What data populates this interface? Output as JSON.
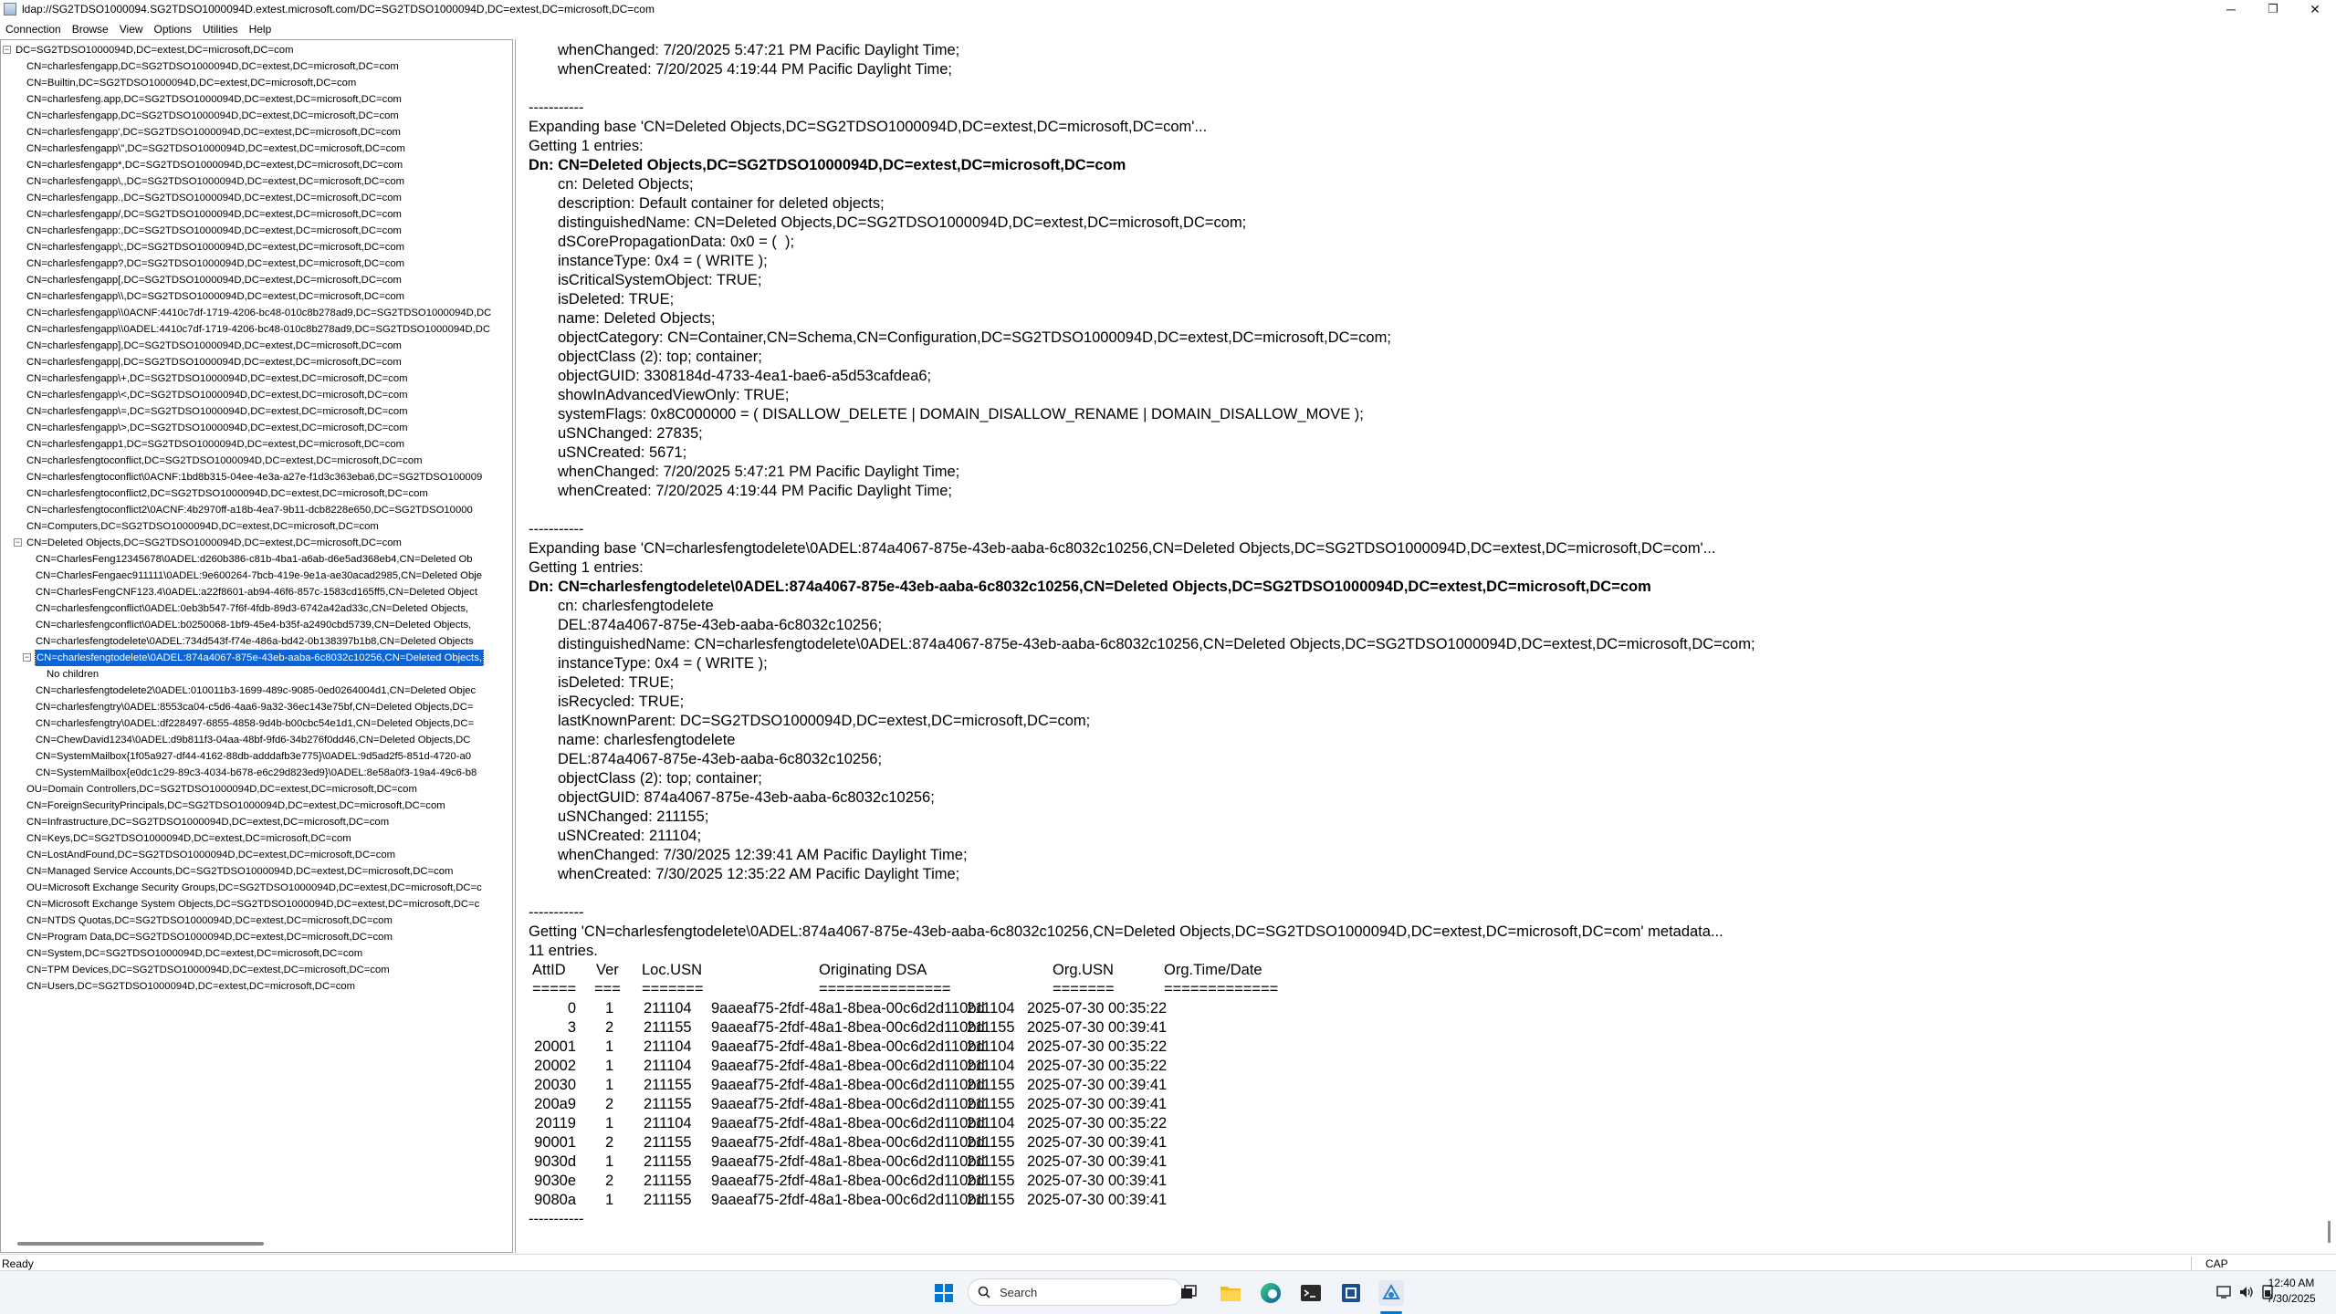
{
  "window": {
    "title": "ldap://SG2TDSO1000094.SG2TDSO1000094D.extest.microsoft.com/DC=SG2TDSO1000094D,DC=extest,DC=microsoft,DC=com",
    "minimize": "─",
    "maximize": "❐",
    "close": "✕"
  },
  "menu": [
    "Connection",
    "Browse",
    "View",
    "Options",
    "Utilities",
    "Help"
  ],
  "tree": [
    {
      "label": "DC=SG2TDSO1000094D,DC=extest,DC=microsoft,DC=com",
      "level": 0,
      "expander": "−"
    },
    {
      "label": "CN=charlesfengapp,DC=SG2TDSO1000094D,DC=extest,DC=microsoft,DC=com",
      "level": 1
    },
    {
      "label": "CN=Builtin,DC=SG2TDSO1000094D,DC=extest,DC=microsoft,DC=com",
      "level": 1
    },
    {
      "label": "CN=charlesfeng.app,DC=SG2TDSO1000094D,DC=extest,DC=microsoft,DC=com",
      "level": 1
    },
    {
      "label": "CN=charlesfengapp,DC=SG2TDSO1000094D,DC=extest,DC=microsoft,DC=com",
      "level": 1
    },
    {
      "label": "CN=charlesfengapp',DC=SG2TDSO1000094D,DC=extest,DC=microsoft,DC=com",
      "level": 1
    },
    {
      "label": "CN=charlesfengapp\\\",DC=SG2TDSO1000094D,DC=extest,DC=microsoft,DC=com",
      "level": 1
    },
    {
      "label": "CN=charlesfengapp*,DC=SG2TDSO1000094D,DC=extest,DC=microsoft,DC=com",
      "level": 1
    },
    {
      "label": "CN=charlesfengapp\\,,DC=SG2TDSO1000094D,DC=extest,DC=microsoft,DC=com",
      "level": 1
    },
    {
      "label": "CN=charlesfengapp.,DC=SG2TDSO1000094D,DC=extest,DC=microsoft,DC=com",
      "level": 1
    },
    {
      "label": "CN=charlesfengapp/,DC=SG2TDSO1000094D,DC=extest,DC=microsoft,DC=com",
      "level": 1
    },
    {
      "label": "CN=charlesfengapp:,DC=SG2TDSO1000094D,DC=extest,DC=microsoft,DC=com",
      "level": 1
    },
    {
      "label": "CN=charlesfengapp\\;,DC=SG2TDSO1000094D,DC=extest,DC=microsoft,DC=com",
      "level": 1
    },
    {
      "label": "CN=charlesfengapp?,DC=SG2TDSO1000094D,DC=extest,DC=microsoft,DC=com",
      "level": 1
    },
    {
      "label": "CN=charlesfengapp[,DC=SG2TDSO1000094D,DC=extest,DC=microsoft,DC=com",
      "level": 1
    },
    {
      "label": "CN=charlesfengapp\\\\,DC=SG2TDSO1000094D,DC=extest,DC=microsoft,DC=com",
      "level": 1
    },
    {
      "label": "CN=charlesfengapp\\\\0ACNF:4410c7df-1719-4206-bc48-010c8b278ad9,DC=SG2TDSO1000094D,DC",
      "level": 1
    },
    {
      "label": "CN=charlesfengapp\\\\0ADEL:4410c7df-1719-4206-bc48-010c8b278ad9,DC=SG2TDSO1000094D,DC",
      "level": 1
    },
    {
      "label": "CN=charlesfengapp],DC=SG2TDSO1000094D,DC=extest,DC=microsoft,DC=com",
      "level": 1
    },
    {
      "label": "CN=charlesfengapp|,DC=SG2TDSO1000094D,DC=extest,DC=microsoft,DC=com",
      "level": 1
    },
    {
      "label": "CN=charlesfengapp\\+,DC=SG2TDSO1000094D,DC=extest,DC=microsoft,DC=com",
      "level": 1
    },
    {
      "label": "CN=charlesfengapp\\<,DC=SG2TDSO1000094D,DC=extest,DC=microsoft,DC=com",
      "level": 1
    },
    {
      "label": "CN=charlesfengapp\\=,DC=SG2TDSO1000094D,DC=extest,DC=microsoft,DC=com",
      "level": 1
    },
    {
      "label": "CN=charlesfengapp\\>,DC=SG2TDSO1000094D,DC=extest,DC=microsoft,DC=com",
      "level": 1
    },
    {
      "label": "CN=charlesfengapp1,DC=SG2TDSO1000094D,DC=extest,DC=microsoft,DC=com",
      "level": 1
    },
    {
      "label": "CN=charlesfengtoconflict,DC=SG2TDSO1000094D,DC=extest,DC=microsoft,DC=com",
      "level": 1
    },
    {
      "label": "CN=charlesfengtoconflict\\0ACNF:1bd8b315-04ee-4e3a-a27e-f1d3c363eba6,DC=SG2TDSO100009",
      "level": 1
    },
    {
      "label": "CN=charlesfengtoconflict2,DC=SG2TDSO1000094D,DC=extest,DC=microsoft,DC=com",
      "level": 1
    },
    {
      "label": "CN=charlesfengtoconflict2\\0ACNF:4b2970ff-a18b-4ea7-9b11-dcb8228e650,DC=SG2TDSO10000",
      "level": 1
    },
    {
      "label": "CN=Computers,DC=SG2TDSO1000094D,DC=extest,DC=microsoft,DC=com",
      "level": 1
    },
    {
      "label": "CN=Deleted Objects,DC=SG2TDSO1000094D,DC=extest,DC=microsoft,DC=com",
      "level": 1,
      "expander": "−"
    },
    {
      "label": "CN=CharlesFeng12345678\\0ADEL:d260b386-c81b-4ba1-a6ab-d6e5ad368eb4,CN=Deleted Ob",
      "level": 2
    },
    {
      "label": "CN=CharlesFengaec911111\\0ADEL:9e600264-7bcb-419e-9e1a-ae30acad2985,CN=Deleted Obje",
      "level": 2
    },
    {
      "label": "CN=CharlesFengCNF123.4\\0ADEL:a22f8601-ab94-46f6-857c-1583cd165ff5,CN=Deleted Object",
      "level": 2
    },
    {
      "label": "CN=charlesfengconflict\\0ADEL:0eb3b547-7f6f-4fdb-89d3-6742a42ad33c,CN=Deleted Objects,",
      "level": 2
    },
    {
      "label": "CN=charlesfengconflict\\0ADEL:b0250068-1bf9-45e4-b35f-a2490cbd5739,CN=Deleted Objects,",
      "level": 2
    },
    {
      "label": "CN=charlesfengtodelete\\0ADEL:734d543f-f74e-486a-bd42-0b138397b1b8,CN=Deleted Objects",
      "level": 2
    },
    {
      "label": "CN=charlesfengtodelete\\0ADEL:874a4067-875e-43eb-aaba-6c8032c10256,CN=Deleted Objects,",
      "level": 2,
      "expander": "−",
      "selected": true
    },
    {
      "label": "No children",
      "level": 3
    },
    {
      "label": "CN=charlesfengtodelete2\\0ADEL:010011b3-1699-489c-9085-0ed0264004d1,CN=Deleted Objec",
      "level": 2
    },
    {
      "label": "CN=charlesfengtry\\0ADEL:8553ca04-c5d6-4aa6-9a32-36ec143e75bf,CN=Deleted Objects,DC=",
      "level": 2
    },
    {
      "label": "CN=charlesfengtry\\0ADEL:df228497-6855-4858-9d4b-b00cbc54e1d1,CN=Deleted Objects,DC=",
      "level": 2
    },
    {
      "label": "CN=ChewDavid1234\\0ADEL:d9b811f3-04aa-48bf-9fd6-34b276f0dd46,CN=Deleted Objects,DC",
      "level": 2
    },
    {
      "label": "CN=SystemMailbox{1f05a927-df44-4162-88db-adddafb3e775}\\0ADEL:9d5ad2f5-851d-4720-a0",
      "level": 2
    },
    {
      "label": "CN=SystemMailbox{e0dc1c29-89c3-4034-b678-e6c29d823ed9}\\0ADEL:8e58a0f3-19a4-49c6-b8",
      "level": 2
    },
    {
      "label": "OU=Domain Controllers,DC=SG2TDSO1000094D,DC=extest,DC=microsoft,DC=com",
      "level": 1
    },
    {
      "label": "CN=ForeignSecurityPrincipals,DC=SG2TDSO1000094D,DC=extest,DC=microsoft,DC=com",
      "level": 1
    },
    {
      "label": "CN=Infrastructure,DC=SG2TDSO1000094D,DC=extest,DC=microsoft,DC=com",
      "level": 1
    },
    {
      "label": "CN=Keys,DC=SG2TDSO1000094D,DC=extest,DC=microsoft,DC=com",
      "level": 1
    },
    {
      "label": "CN=LostAndFound,DC=SG2TDSO1000094D,DC=extest,DC=microsoft,DC=com",
      "level": 1
    },
    {
      "label": "CN=Managed Service Accounts,DC=SG2TDSO1000094D,DC=extest,DC=microsoft,DC=com",
      "level": 1
    },
    {
      "label": "OU=Microsoft Exchange Security Groups,DC=SG2TDSO1000094D,DC=extest,DC=microsoft,DC=c",
      "level": 1
    },
    {
      "label": "CN=Microsoft Exchange System Objects,DC=SG2TDSO1000094D,DC=extest,DC=microsoft,DC=c",
      "level": 1
    },
    {
      "label": "CN=NTDS Quotas,DC=SG2TDSO1000094D,DC=extest,DC=microsoft,DC=com",
      "level": 1
    },
    {
      "label": "CN=Program Data,DC=SG2TDSO1000094D,DC=extest,DC=microsoft,DC=com",
      "level": 1
    },
    {
      "label": "CN=System,DC=SG2TDSO1000094D,DC=extest,DC=microsoft,DC=com",
      "level": 1
    },
    {
      "label": "CN=TPM Devices,DC=SG2TDSO1000094D,DC=extest,DC=microsoft,DC=com",
      "level": 1
    },
    {
      "label": "CN=Users,DC=SG2TDSO1000094D,DC=extest,DC=microsoft,DC=com",
      "level": 1
    }
  ],
  "output_lines": [
    {
      "text": "whenChanged: 7/20/2025 5:47:21 PM Pacific Daylight Time;",
      "indent": true
    },
    {
      "text": "whenCreated: 7/20/2025 4:19:44 PM Pacific Daylight Time;",
      "indent": true
    },
    {
      "text": ""
    },
    {
      "text": "-----------"
    },
    {
      "text": "Expanding base 'CN=Deleted Objects,DC=SG2TDSO1000094D,DC=extest,DC=microsoft,DC=com'..."
    },
    {
      "text": "Getting 1 entries:"
    },
    {
      "text": "Dn: CN=Deleted Objects,DC=SG2TDSO1000094D,DC=extest,DC=microsoft,DC=com",
      "bold": true
    },
    {
      "text": "cn: Deleted Objects;",
      "indent": true
    },
    {
      "text": "description: Default container for deleted objects;",
      "indent": true
    },
    {
      "text": "distinguishedName: CN=Deleted Objects,DC=SG2TDSO1000094D,DC=extest,DC=microsoft,DC=com;",
      "indent": true
    },
    {
      "text": "dSCorePropagationData: 0x0 = (  );",
      "indent": true
    },
    {
      "text": "instanceType: 0x4 = ( WRITE );",
      "indent": true
    },
    {
      "text": "isCriticalSystemObject: TRUE;",
      "indent": true
    },
    {
      "text": "isDeleted: TRUE;",
      "indent": true
    },
    {
      "text": "name: Deleted Objects;",
      "indent": true
    },
    {
      "text": "objectCategory: CN=Container,CN=Schema,CN=Configuration,DC=SG2TDSO1000094D,DC=extest,DC=microsoft,DC=com;",
      "indent": true
    },
    {
      "text": "objectClass (2): top; container;",
      "indent": true
    },
    {
      "text": "objectGUID: 3308184d-4733-4ea1-bae6-a5d53cafdea6;",
      "indent": true
    },
    {
      "text": "showInAdvancedViewOnly: TRUE;",
      "indent": true
    },
    {
      "text": "systemFlags: 0x8C000000 = ( DISALLOW_DELETE | DOMAIN_DISALLOW_RENAME | DOMAIN_DISALLOW_MOVE );",
      "indent": true
    },
    {
      "text": "uSNChanged: 27835;",
      "indent": true
    },
    {
      "text": "uSNCreated: 5671;",
      "indent": true
    },
    {
      "text": "whenChanged: 7/20/2025 5:47:21 PM Pacific Daylight Time;",
      "indent": true
    },
    {
      "text": "whenCreated: 7/20/2025 4:19:44 PM Pacific Daylight Time;",
      "indent": true
    },
    {
      "text": ""
    },
    {
      "text": "-----------"
    },
    {
      "text": "Expanding base 'CN=charlesfengtodelete\\0ADEL:874a4067-875e-43eb-aaba-6c8032c10256,CN=Deleted Objects,DC=SG2TDSO1000094D,DC=extest,DC=microsoft,DC=com'..."
    },
    {
      "text": "Getting 1 entries:"
    },
    {
      "text": "Dn: CN=charlesfengtodelete\\0ADEL:874a4067-875e-43eb-aaba-6c8032c10256,CN=Deleted Objects,DC=SG2TDSO1000094D,DC=extest,DC=microsoft,DC=com",
      "bold": true
    },
    {
      "text": "cn: charlesfengtodelete",
      "indent": true
    },
    {
      "text": "DEL:874a4067-875e-43eb-aaba-6c8032c10256;",
      "indent": true
    },
    {
      "text": "distinguishedName: CN=charlesfengtodelete\\0ADEL:874a4067-875e-43eb-aaba-6c8032c10256,CN=Deleted Objects,DC=SG2TDSO1000094D,DC=extest,DC=microsoft,DC=com;",
      "indent": true
    },
    {
      "text": "instanceType: 0x4 = ( WRITE );",
      "indent": true
    },
    {
      "text": "isDeleted: TRUE;",
      "indent": true
    },
    {
      "text": "isRecycled: TRUE;",
      "indent": true
    },
    {
      "text": "lastKnownParent: DC=SG2TDSO1000094D,DC=extest,DC=microsoft,DC=com;",
      "indent": true
    },
    {
      "text": "name: charlesfengtodelete",
      "indent": true
    },
    {
      "text": "DEL:874a4067-875e-43eb-aaba-6c8032c10256;",
      "indent": true
    },
    {
      "text": "objectClass (2): top; container;",
      "indent": true
    },
    {
      "text": "objectGUID: 874a4067-875e-43eb-aaba-6c8032c10256;",
      "indent": true
    },
    {
      "text": "uSNChanged: 211155;",
      "indent": true
    },
    {
      "text": "uSNCreated: 211104;",
      "indent": true
    },
    {
      "text": "whenChanged: 7/30/2025 12:39:41 AM Pacific Daylight Time;",
      "indent": true
    },
    {
      "text": "whenCreated: 7/30/2025 12:35:22 AM Pacific Daylight Time;",
      "indent": true
    },
    {
      "text": ""
    },
    {
      "text": "-----------"
    },
    {
      "text": "Getting 'CN=charlesfengtodelete\\0ADEL:874a4067-875e-43eb-aaba-6c8032c10256,CN=Deleted Objects,DC=SG2TDSO1000094D,DC=extest,DC=microsoft,DC=com' metadata..."
    },
    {
      "text": "11 entries."
    }
  ],
  "metadata_table": {
    "headers": [
      "AttID",
      "Ver",
      "Loc.USN",
      "Originating DSA",
      "Org.USN",
      "Org.Time/Date"
    ],
    "underlines": [
      "=====",
      "===",
      "=======",
      "===============",
      "=======",
      "============="
    ],
    "rows": [
      [
        "0",
        "1",
        "211104",
        "9aaeaf75-2fdf-48a1-8bea-00c6d2d110bd",
        "211104",
        "2025-07-30 00:35:22"
      ],
      [
        "3",
        "2",
        "211155",
        "9aaeaf75-2fdf-48a1-8bea-00c6d2d110bd",
        "211155",
        "2025-07-30 00:39:41"
      ],
      [
        "20001",
        "1",
        "211104",
        "9aaeaf75-2fdf-48a1-8bea-00c6d2d110bd",
        "211104",
        "2025-07-30 00:35:22"
      ],
      [
        "20002",
        "1",
        "211104",
        "9aaeaf75-2fdf-48a1-8bea-00c6d2d110bd",
        "211104",
        "2025-07-30 00:35:22"
      ],
      [
        "20030",
        "1",
        "211155",
        "9aaeaf75-2fdf-48a1-8bea-00c6d2d110bd",
        "211155",
        "2025-07-30 00:39:41"
      ],
      [
        "200a9",
        "2",
        "211155",
        "9aaeaf75-2fdf-48a1-8bea-00c6d2d110bd",
        "211155",
        "2025-07-30 00:39:41"
      ],
      [
        "20119",
        "1",
        "211104",
        "9aaeaf75-2fdf-48a1-8bea-00c6d2d110bd",
        "211104",
        "2025-07-30 00:35:22"
      ],
      [
        "90001",
        "2",
        "211155",
        "9aaeaf75-2fdf-48a1-8bea-00c6d2d110bd",
        "211155",
        "2025-07-30 00:39:41"
      ],
      [
        "9030d",
        "1",
        "211155",
        "9aaeaf75-2fdf-48a1-8bea-00c6d2d110bd",
        "211155",
        "2025-07-30 00:39:41"
      ],
      [
        "9030e",
        "2",
        "211155",
        "9aaeaf75-2fdf-48a1-8bea-00c6d2d110bd",
        "211155",
        "2025-07-30 00:39:41"
      ],
      [
        "9080a",
        "1",
        "211155",
        "9aaeaf75-2fdf-48a1-8bea-00c6d2d110bd",
        "211155",
        "2025-07-30 00:39:41"
      ]
    ],
    "footer": "-----------"
  },
  "status": {
    "ready": "Ready",
    "cap": "CAP"
  },
  "taskbar": {
    "search_placeholder": "Search",
    "time": "12:40 AM",
    "date": "7/30/2025",
    "icons": [
      "windows-start-icon",
      "search-icon",
      "task-view-icon",
      "file-explorer-icon",
      "edge-browser-icon",
      "terminal-icon",
      "app-icon",
      "ldp-app-icon"
    ]
  },
  "colors": {
    "selection": "#0a64d6",
    "windows_blue": "#0078d4"
  }
}
